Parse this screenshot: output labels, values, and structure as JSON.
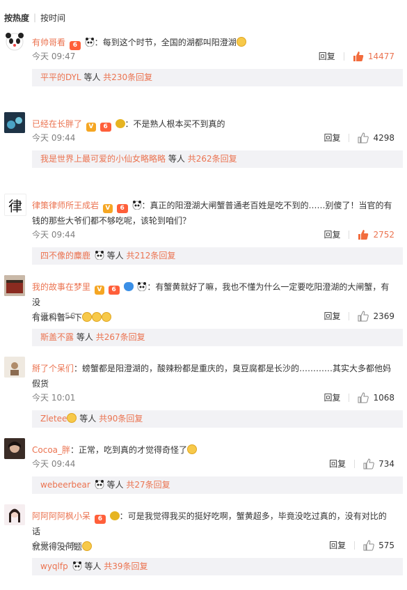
{
  "sort": {
    "hot": "按热度",
    "time": "按时间"
  },
  "labels": {
    "reply": "回复",
    "and_others": "等人",
    "colon": "："
  },
  "comments": [
    {
      "user": "有帅哥看",
      "text": "每到这个时节，全国的湖都叫阳澄湖",
      "time": "今天 09:47",
      "likes": "14477",
      "liked": true,
      "sub_user": "平平的DYL",
      "sub_count": "共230条回复"
    },
    {
      "user": "已经在长胖了",
      "text": "不是熟人根本买不到真的",
      "time": "今天 09:44",
      "likes": "4298",
      "liked": false,
      "sub_user": "我是世界上最可爱的小仙女略略略",
      "sub_count": "共262条回复"
    },
    {
      "user": "律策律师所王成岩",
      "text": "真正的阳澄湖大闸蟹普通老百姓是吃不到的……别傻了！当官的有",
      "text2": "钱的那些大爷们都不够吃呢，该轮到咱们？",
      "time": "今天 09:44",
      "likes": "2752",
      "liked": true,
      "sub_user": "四不像的麋鹿",
      "sub_count": "共212条回复"
    },
    {
      "user": "我的故事在梦里",
      "text": "有蟹黄就好了嘛，我也不懂为什么一定要吃阳澄湖的大闸蟹，有没",
      "text2": "有谁科普一下",
      "time": "今天 09:56",
      "likes": "2369",
      "liked": false,
      "sub_user": "斯盖不露",
      "sub_count": "共267条回复"
    },
    {
      "user": "掰了个呆们",
      "text": "螃蟹都是阳澄湖的，酸辣粉都是重庆的，臭豆腐都是长沙的…………其实大多都他妈",
      "text2": "假货",
      "time": "今天 10:01",
      "likes": "1068",
      "liked": false,
      "sub_user": "Zletee",
      "sub_count": "共90条回复"
    },
    {
      "user": "Cocoa_胖",
      "text": "正常，吃到真的才觉得奇怪了",
      "time": "今天 09:44",
      "likes": "734",
      "liked": false,
      "sub_user": "webeerbear",
      "sub_count": "共27条回复"
    },
    {
      "user": "阿阿阿阿枫小呆",
      "text": "可是我觉得我买的挺好吃啊，蟹黄超多，毕竟没吃过真的，没有对比的话",
      "text2": "就觉得没问题",
      "time": "今天 09:49",
      "likes": "575",
      "liked": false,
      "sub_user": "wyqlfp",
      "sub_count": "共39条回复"
    }
  ],
  "colors": {
    "accent": "#eb7350",
    "sub_bg": "#f2f2f5",
    "meta": "#808080"
  }
}
